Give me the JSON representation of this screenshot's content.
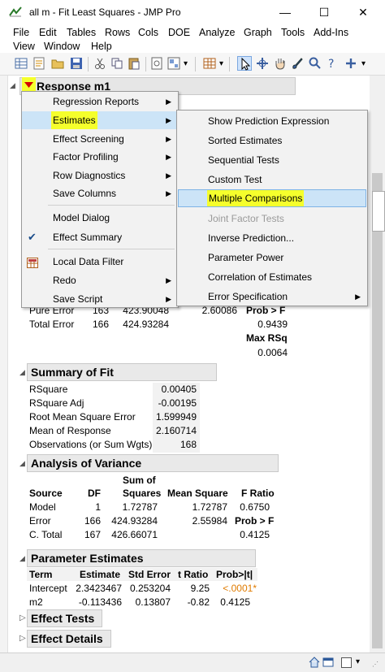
{
  "window": {
    "title": "all m - Fit Least Squares - JMP Pro",
    "minimize": "—",
    "maximize": "☐",
    "close": "✕"
  },
  "menubar": {
    "items": [
      "File",
      "Edit",
      "Tables",
      "Rows",
      "Cols",
      "DOE",
      "Analyze",
      "Graph",
      "Tools",
      "Add-Ins",
      "View",
      "Window",
      "Help"
    ]
  },
  "report": {
    "response_title": "Response m1",
    "lack_of_fit_partial": {
      "pure_error": {
        "label": "Pure Error",
        "df": "163",
        "ss": "423.90048",
        "ms": "2.60086"
      },
      "total_error": {
        "label": "Total Error",
        "df": "166",
        "ss": "424.93284"
      },
      "prob_f_label": "Prob > F",
      "prob_f_value": "0.9439",
      "max_rsq_label": "Max RSq",
      "max_rsq_value": "0.0064"
    },
    "summary_of_fit": {
      "title": "Summary of Fit",
      "rows": [
        {
          "label": "RSquare",
          "value": "0.00405"
        },
        {
          "label": "RSquare Adj",
          "value": "-0.00195"
        },
        {
          "label": "Root Mean Square Error",
          "value": "1.599949"
        },
        {
          "label": "Mean of Response",
          "value": "2.160714"
        },
        {
          "label": "Observations (or Sum Wgts)",
          "value": "168"
        }
      ]
    },
    "anova": {
      "title": "Analysis of Variance",
      "headers": {
        "source": "Source",
        "df": "DF",
        "ss_top": "Sum of",
        "ss_bottom": "Squares",
        "ms": "Mean Square",
        "f": "F Ratio"
      },
      "rows": [
        {
          "source": "Model",
          "df": "1",
          "ss": "1.72787",
          "ms": "1.72787",
          "f": "0.6750"
        },
        {
          "source": "Error",
          "df": "166",
          "ss": "424.93284",
          "ms": "2.55984",
          "f": "Prob > F"
        },
        {
          "source": "C. Total",
          "df": "167",
          "ss": "426.66071",
          "ms": "",
          "f": "0.4125"
        }
      ]
    },
    "parameter_estimates": {
      "title": "Parameter Estimates",
      "headers": {
        "term": "Term",
        "estimate": "Estimate",
        "stderr": "Std Error",
        "t": "t Ratio",
        "p": "Prob>|t|"
      },
      "rows": [
        {
          "term": "Intercept",
          "estimate": "2.3423467",
          "stderr": "0.253204",
          "t": "9.25",
          "p": "<.0001*",
          "p_color": "#e07b00"
        },
        {
          "term": "m2",
          "estimate": "-0.113436",
          "stderr": "0.13807",
          "t": "-0.82",
          "p": "0.4125",
          "p_color": "#000000"
        }
      ]
    },
    "effect_tests": "Effect Tests",
    "effect_details": "Effect Details"
  },
  "context_menu": {
    "items": [
      {
        "label": "Regression Reports",
        "arrow": "▶"
      },
      {
        "label": "Estimates",
        "arrow": "▶"
      },
      {
        "label": "Effect Screening",
        "arrow": "▶"
      },
      {
        "label": "Factor Profiling",
        "arrow": "▶"
      },
      {
        "label": "Row Diagnostics",
        "arrow": "▶"
      },
      {
        "label": "Save Columns",
        "arrow": "▶"
      },
      {
        "label": "Model Dialog",
        "arrow": ""
      },
      {
        "label": "Effect Summary",
        "arrow": ""
      },
      {
        "label": "Local Data Filter",
        "arrow": ""
      },
      {
        "label": "Redo",
        "arrow": "▶"
      },
      {
        "label": "Save Script",
        "arrow": "▶"
      }
    ]
  },
  "submenu": {
    "items": [
      {
        "label": "Show Prediction Expression"
      },
      {
        "label": "Sorted Estimates"
      },
      {
        "label": "Sequential Tests"
      },
      {
        "label": "Custom Test"
      },
      {
        "label": "Multiple Comparisons"
      },
      {
        "label": "Joint Factor Tests"
      },
      {
        "label": "Inverse Prediction..."
      },
      {
        "label": "Parameter Power"
      },
      {
        "label": "Correlation of Estimates"
      },
      {
        "label": "Error Specification",
        "arrow": "▶"
      }
    ]
  },
  "colors": {
    "highlight_yellow": "#f5ff2c",
    "menu_selected_blue": "#cce4f7",
    "disabled_text": "#9a9a9a",
    "red_triangle": "#d20000"
  }
}
